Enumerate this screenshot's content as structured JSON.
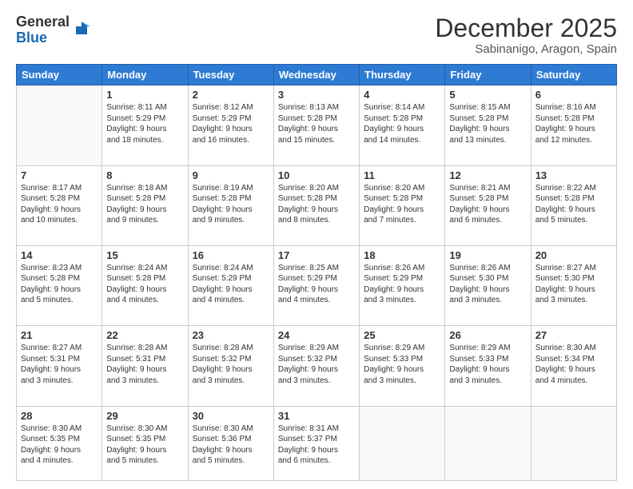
{
  "header": {
    "logo_general": "General",
    "logo_blue": "Blue",
    "month_title": "December 2025",
    "subtitle": "Sabinanigo, Aragon, Spain"
  },
  "days_of_week": [
    "Sunday",
    "Monday",
    "Tuesday",
    "Wednesday",
    "Thursday",
    "Friday",
    "Saturday"
  ],
  "weeks": [
    [
      {
        "day": "",
        "info": ""
      },
      {
        "day": "1",
        "info": "Sunrise: 8:11 AM\nSunset: 5:29 PM\nDaylight: 9 hours\nand 18 minutes."
      },
      {
        "day": "2",
        "info": "Sunrise: 8:12 AM\nSunset: 5:29 PM\nDaylight: 9 hours\nand 16 minutes."
      },
      {
        "day": "3",
        "info": "Sunrise: 8:13 AM\nSunset: 5:28 PM\nDaylight: 9 hours\nand 15 minutes."
      },
      {
        "day": "4",
        "info": "Sunrise: 8:14 AM\nSunset: 5:28 PM\nDaylight: 9 hours\nand 14 minutes."
      },
      {
        "day": "5",
        "info": "Sunrise: 8:15 AM\nSunset: 5:28 PM\nDaylight: 9 hours\nand 13 minutes."
      },
      {
        "day": "6",
        "info": "Sunrise: 8:16 AM\nSunset: 5:28 PM\nDaylight: 9 hours\nand 12 minutes."
      }
    ],
    [
      {
        "day": "7",
        "info": "Sunrise: 8:17 AM\nSunset: 5:28 PM\nDaylight: 9 hours\nand 10 minutes."
      },
      {
        "day": "8",
        "info": "Sunrise: 8:18 AM\nSunset: 5:28 PM\nDaylight: 9 hours\nand 9 minutes."
      },
      {
        "day": "9",
        "info": "Sunrise: 8:19 AM\nSunset: 5:28 PM\nDaylight: 9 hours\nand 9 minutes."
      },
      {
        "day": "10",
        "info": "Sunrise: 8:20 AM\nSunset: 5:28 PM\nDaylight: 9 hours\nand 8 minutes."
      },
      {
        "day": "11",
        "info": "Sunrise: 8:20 AM\nSunset: 5:28 PM\nDaylight: 9 hours\nand 7 minutes."
      },
      {
        "day": "12",
        "info": "Sunrise: 8:21 AM\nSunset: 5:28 PM\nDaylight: 9 hours\nand 6 minutes."
      },
      {
        "day": "13",
        "info": "Sunrise: 8:22 AM\nSunset: 5:28 PM\nDaylight: 9 hours\nand 5 minutes."
      }
    ],
    [
      {
        "day": "14",
        "info": "Sunrise: 8:23 AM\nSunset: 5:28 PM\nDaylight: 9 hours\nand 5 minutes."
      },
      {
        "day": "15",
        "info": "Sunrise: 8:24 AM\nSunset: 5:28 PM\nDaylight: 9 hours\nand 4 minutes."
      },
      {
        "day": "16",
        "info": "Sunrise: 8:24 AM\nSunset: 5:29 PM\nDaylight: 9 hours\nand 4 minutes."
      },
      {
        "day": "17",
        "info": "Sunrise: 8:25 AM\nSunset: 5:29 PM\nDaylight: 9 hours\nand 4 minutes."
      },
      {
        "day": "18",
        "info": "Sunrise: 8:26 AM\nSunset: 5:29 PM\nDaylight: 9 hours\nand 3 minutes."
      },
      {
        "day": "19",
        "info": "Sunrise: 8:26 AM\nSunset: 5:30 PM\nDaylight: 9 hours\nand 3 minutes."
      },
      {
        "day": "20",
        "info": "Sunrise: 8:27 AM\nSunset: 5:30 PM\nDaylight: 9 hours\nand 3 minutes."
      }
    ],
    [
      {
        "day": "21",
        "info": "Sunrise: 8:27 AM\nSunset: 5:31 PM\nDaylight: 9 hours\nand 3 minutes."
      },
      {
        "day": "22",
        "info": "Sunrise: 8:28 AM\nSunset: 5:31 PM\nDaylight: 9 hours\nand 3 minutes."
      },
      {
        "day": "23",
        "info": "Sunrise: 8:28 AM\nSunset: 5:32 PM\nDaylight: 9 hours\nand 3 minutes."
      },
      {
        "day": "24",
        "info": "Sunrise: 8:29 AM\nSunset: 5:32 PM\nDaylight: 9 hours\nand 3 minutes."
      },
      {
        "day": "25",
        "info": "Sunrise: 8:29 AM\nSunset: 5:33 PM\nDaylight: 9 hours\nand 3 minutes."
      },
      {
        "day": "26",
        "info": "Sunrise: 8:29 AM\nSunset: 5:33 PM\nDaylight: 9 hours\nand 3 minutes."
      },
      {
        "day": "27",
        "info": "Sunrise: 8:30 AM\nSunset: 5:34 PM\nDaylight: 9 hours\nand 4 minutes."
      }
    ],
    [
      {
        "day": "28",
        "info": "Sunrise: 8:30 AM\nSunset: 5:35 PM\nDaylight: 9 hours\nand 4 minutes."
      },
      {
        "day": "29",
        "info": "Sunrise: 8:30 AM\nSunset: 5:35 PM\nDaylight: 9 hours\nand 5 minutes."
      },
      {
        "day": "30",
        "info": "Sunrise: 8:30 AM\nSunset: 5:36 PM\nDaylight: 9 hours\nand 5 minutes."
      },
      {
        "day": "31",
        "info": "Sunrise: 8:31 AM\nSunset: 5:37 PM\nDaylight: 9 hours\nand 6 minutes."
      },
      {
        "day": "",
        "info": ""
      },
      {
        "day": "",
        "info": ""
      },
      {
        "day": "",
        "info": ""
      }
    ]
  ]
}
